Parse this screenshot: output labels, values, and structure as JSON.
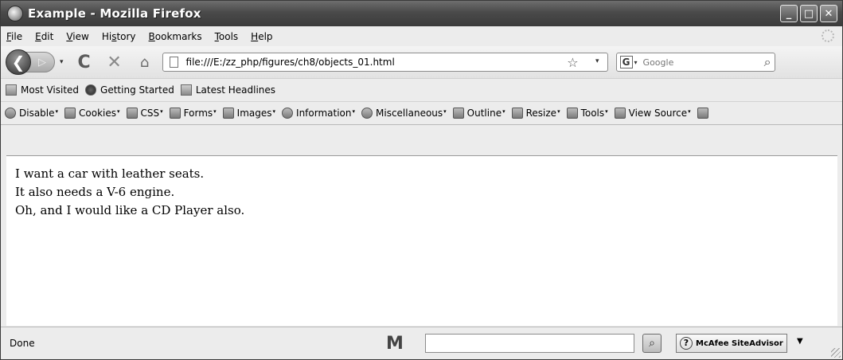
{
  "window": {
    "title": "Example - Mozilla Firefox",
    "controls": {
      "minimize": "_",
      "maximize": "□",
      "close": "✕"
    }
  },
  "menu": {
    "items": [
      {
        "pre": "",
        "u": "F",
        "post": "ile"
      },
      {
        "pre": "",
        "u": "E",
        "post": "dit"
      },
      {
        "pre": "",
        "u": "V",
        "post": "iew"
      },
      {
        "pre": "Hi",
        "u": "s",
        "post": "tory"
      },
      {
        "pre": "",
        "u": "B",
        "post": "ookmarks"
      },
      {
        "pre": "",
        "u": "T",
        "post": "ools"
      },
      {
        "pre": "",
        "u": "H",
        "post": "elp"
      }
    ]
  },
  "nav": {
    "back_glyph": "❮",
    "forward_glyph": "▷",
    "dropdown_glyph": "▾",
    "reload_glyph": "C",
    "stop_glyph": "✕",
    "home_glyph": "⌂",
    "url": "file:///E:/zz_php/figures/ch8/objects_01.html",
    "star_glyph": "☆",
    "url_dropdown_glyph": "▾",
    "search_engine_letter": "G",
    "search_engine_dd": "▾",
    "search_placeholder": "Google",
    "search_go_glyph": "⌕"
  },
  "bookmarks": {
    "items": [
      "Most Visited",
      "Getting Started",
      "Latest Headlines"
    ]
  },
  "devtoolbar": {
    "items": [
      {
        "label": "Disable",
        "icon": "disable-icon"
      },
      {
        "label": "Cookies",
        "icon": "cookies-icon"
      },
      {
        "label": "CSS",
        "icon": "css-icon"
      },
      {
        "label": "Forms",
        "icon": "forms-icon"
      },
      {
        "label": "Images",
        "icon": "images-icon"
      },
      {
        "label": "Information",
        "icon": "information-icon"
      },
      {
        "label": "Miscellaneous",
        "icon": "miscellaneous-icon"
      },
      {
        "label": "Outline",
        "icon": "outline-icon"
      },
      {
        "label": "Resize",
        "icon": "resize-icon"
      },
      {
        "label": "Tools",
        "icon": "tools-icon"
      },
      {
        "label": "View Source",
        "icon": "view-source-icon"
      }
    ],
    "caret": "▾"
  },
  "content": {
    "lines": [
      "I want a car with leather seats.",
      "It also needs a V-6 engine.",
      "Oh, and I would like a CD Player also."
    ]
  },
  "status": {
    "text": "Done",
    "m_logo": "M",
    "search_value": "",
    "go_glyph": "⌕",
    "advisor_icon": "?",
    "advisor_label": "McAfee SiteAdvisor",
    "advisor_dd": "▼"
  }
}
